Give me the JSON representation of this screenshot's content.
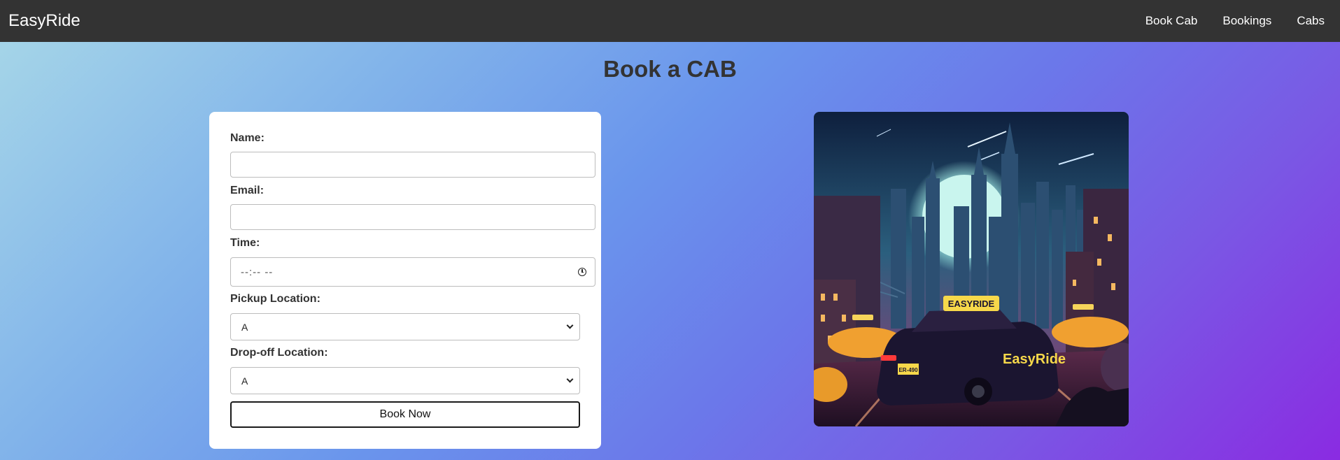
{
  "navbar": {
    "brand": "EasyRide",
    "links": [
      "Book Cab",
      "Bookings",
      "Cabs"
    ]
  },
  "page": {
    "title": "Book a CAB"
  },
  "form": {
    "name_label": "Name:",
    "name_value": "",
    "email_label": "Email:",
    "email_value": "",
    "time_label": "Time:",
    "time_placeholder": "--:-- --",
    "pickup_label": "Pickup Location:",
    "pickup_value": "A",
    "dropoff_label": "Drop-off Location:",
    "dropoff_value": "A",
    "submit_label": "Book Now"
  },
  "illustration": {
    "taxi_sign": "EASYRIDE",
    "car_text": "EasyRide",
    "plate": "ER-490"
  },
  "colors": {
    "navbar": "#333333",
    "gradient_start": "#a8d8e8",
    "gradient_end": "#8a2be2",
    "title": "#333333"
  }
}
